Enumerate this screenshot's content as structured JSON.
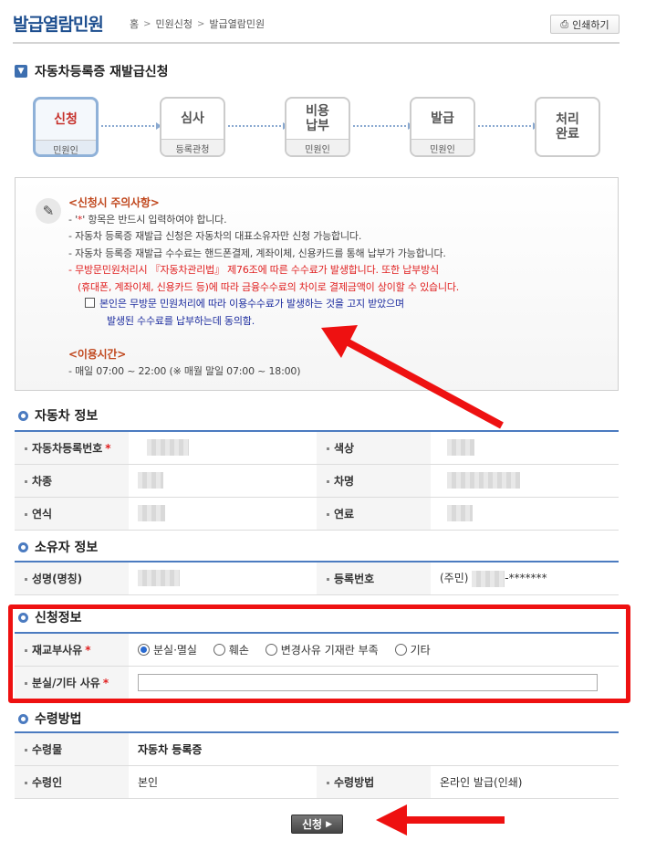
{
  "header": {
    "title": "발급열람민원",
    "breadcrumb": [
      "홈",
      "민원신청",
      "발급열람민원"
    ],
    "print_label": "인쇄하기"
  },
  "section_title": "자동차등록증 재발급신청",
  "steps": [
    {
      "name": "신청",
      "role": "민원인"
    },
    {
      "name": "심사",
      "role": "등록관청"
    },
    {
      "name": "비용\n납부",
      "role": "민원인"
    },
    {
      "name": "발급",
      "role": "민원인"
    },
    {
      "name": "처리\n완료",
      "role": ""
    }
  ],
  "notice": {
    "heading": "<신청시 주의사항>",
    "star_prefix": "- '",
    "star_mark": "*",
    "star_suffix": "' 항목은 반드시 입력하여야 합니다.",
    "line2": "- 자동차 등록증 재발급 신청은 자동차의 대표소유자만 신청 가능합니다.",
    "line3": "- 자동차 등록증 재발급 수수료는 핸드폰결제, 계좌이체, 신용카드를 통해 납부가 가능합니다.",
    "warn1": "- 무방문민원처리시 『자동차관리법』 제76조에 따른 수수료가 발생합니다. 또한 납부방식",
    "warn2": "(휴대폰, 계좌이체, 신용카드 등)에 따라 금융수수료의 차이로 결제금액이 상이할 수 있습니다.",
    "agree1": "본인은 무방문 민원처리에 따라 이용수수료가 발생하는 것을 고지 받았으며",
    "agree2": "발생된 수수료를 납부하는데 동의함.",
    "hours_heading": "<이용시간>",
    "hours": "- 매일 07:00 ~ 22:00 (※ 매월 말일 07:00 ~ 18:00)"
  },
  "vehicle": {
    "title": "자동차 정보",
    "reg_no_label": "자동차등록번호",
    "color_label": "색상",
    "type_label": "차종",
    "name_label": "차명",
    "year_label": "연식",
    "fuel_label": "연료"
  },
  "owner": {
    "title": "소유자 정보",
    "name_label": "성명(명칭)",
    "id_label": "등록번호",
    "id_prefix": "(주민)",
    "id_suffix": "-*******"
  },
  "apply": {
    "title": "신청정보",
    "reason_label": "재교부사유",
    "options": [
      "분실·멸실",
      "훼손",
      "변경사유 기재란 부족",
      "기타"
    ],
    "selected_option": "분실·멸실",
    "detail_label": "분실/기타 사유",
    "detail_value": ""
  },
  "receive": {
    "title": "수령방법",
    "item_label": "수령물",
    "item_value": "자동차 등록증",
    "person_label": "수령인",
    "person_value": "본인",
    "method_label": "수령방법",
    "method_value": "온라인 발급(인쇄)"
  },
  "submit_label": "신청",
  "colors": {
    "accent": "#1d4e8f",
    "highlight": "#ee1111",
    "required": "#e02020"
  }
}
